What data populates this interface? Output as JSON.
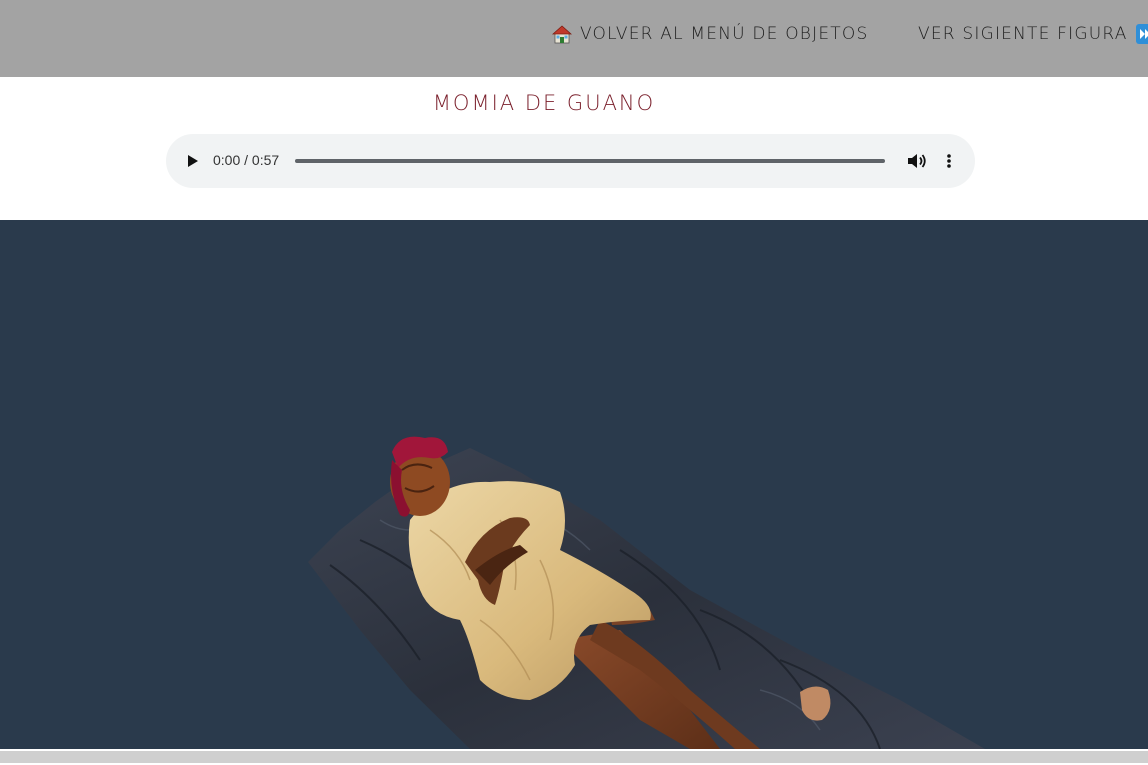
{
  "nav": {
    "home_label": "Volver al Menú de Objetos",
    "home_icon": "house-icon",
    "next_label": "Ver sigiente figura",
    "next_icon": "next-track-icon"
  },
  "title": "Momia de Guano",
  "audio": {
    "time": "0:00 / 0:57",
    "progress": 0
  },
  "viewer": {
    "background": "#2a3a4c"
  },
  "colors": {
    "topbar": "#a3a3a3",
    "title": "#7a1f2b",
    "audio_bg": "#f1f3f4"
  }
}
